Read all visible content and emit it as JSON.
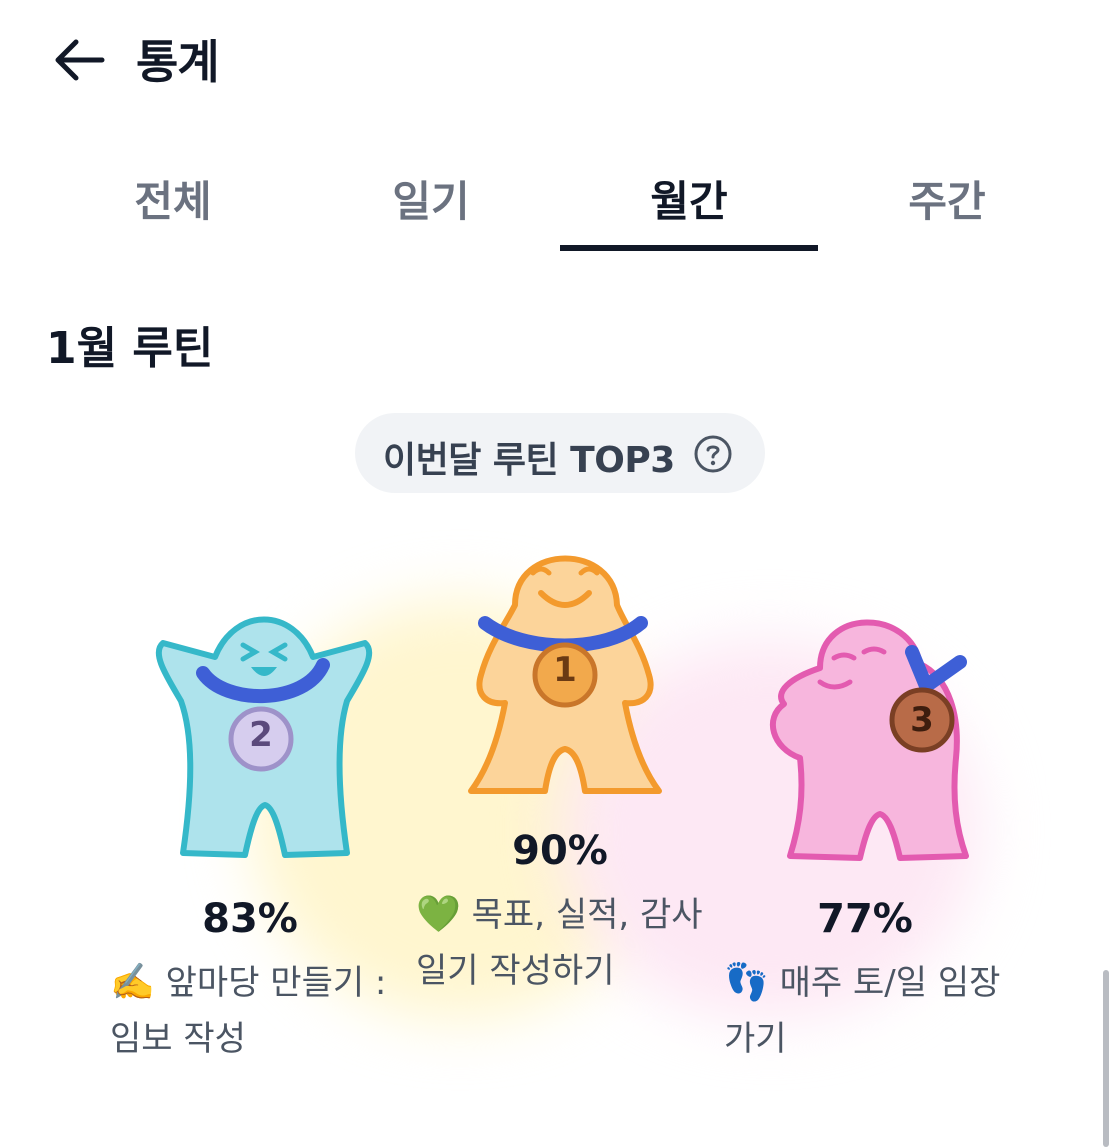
{
  "header": {
    "title": "통계",
    "back_icon": "arrow-left-icon"
  },
  "tabs": [
    {
      "label": "전체",
      "active": false
    },
    {
      "label": "일기",
      "active": false
    },
    {
      "label": "월간",
      "active": true
    },
    {
      "label": "주간",
      "active": false
    }
  ],
  "section": {
    "title": "1월 루틴"
  },
  "top3": {
    "label": "이번달 루틴 TOP3",
    "help_icon": "question-circle-icon"
  },
  "ranks": {
    "first": {
      "rank": "1",
      "percent": "90%",
      "emoji": "💚",
      "routine": "목표, 실적, 감사일기 작성하기",
      "color": "#f5a23a",
      "body_color": "#fcd49a",
      "medal_color": "#f0a14a"
    },
    "second": {
      "rank": "2",
      "percent": "83%",
      "emoji": "✍️",
      "routine": "앞마당 만들기 : 임보 작성",
      "color": "#3bb8c8",
      "body_color": "#a9e2ec",
      "medal_color": "#c9c0e6"
    },
    "third": {
      "rank": "3",
      "percent": "77%",
      "emoji": "👣",
      "routine": "매주 토/일 임장 가기",
      "color": "#e866b8",
      "body_color": "#f7b6dd",
      "medal_color": "#b86b48"
    }
  },
  "colors": {
    "accent": "#111827",
    "ribbon": "#3e5fd6",
    "pill_bg": "#f1f3f6"
  }
}
